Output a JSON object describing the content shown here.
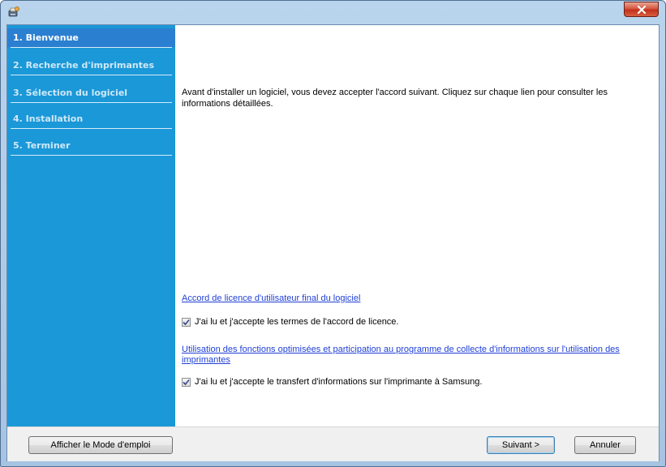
{
  "sidebar": {
    "steps": [
      {
        "label": "1. Bienvenue"
      },
      {
        "label": "2. Recherche d'imprimantes"
      },
      {
        "label": "3. Sélection du logiciel"
      },
      {
        "label": "4. Installation"
      },
      {
        "label": "5. Terminer"
      }
    ],
    "active_index": 0
  },
  "content": {
    "intro": "Avant d'installer un logiciel, vous devez accepter l'accord suivant. Cliquez sur chaque lien pour consulter les informations détaillées.",
    "license_link": "Accord de licence d'utilisateur final du logiciel",
    "license_check": {
      "label": "J'ai lu et j'accepte les termes de l'accord de licence.",
      "checked": true
    },
    "program_link": "Utilisation des fonctions optimisées et participation au programme de collecte d'informations sur l'utilisation des imprimantes",
    "transfer_check": {
      "label": "J'ai lu et j'accepte le transfert d'informations sur l'imprimante à Samsung.",
      "checked": true
    }
  },
  "footer": {
    "manual_button": "Afficher le Mode d'emploi",
    "next_button": "Suivant >",
    "cancel_button": "Annuler"
  },
  "colors": {
    "sidebar": "#1a98d8",
    "active_step": "#2b7fd0",
    "link": "#1f3fd6"
  }
}
